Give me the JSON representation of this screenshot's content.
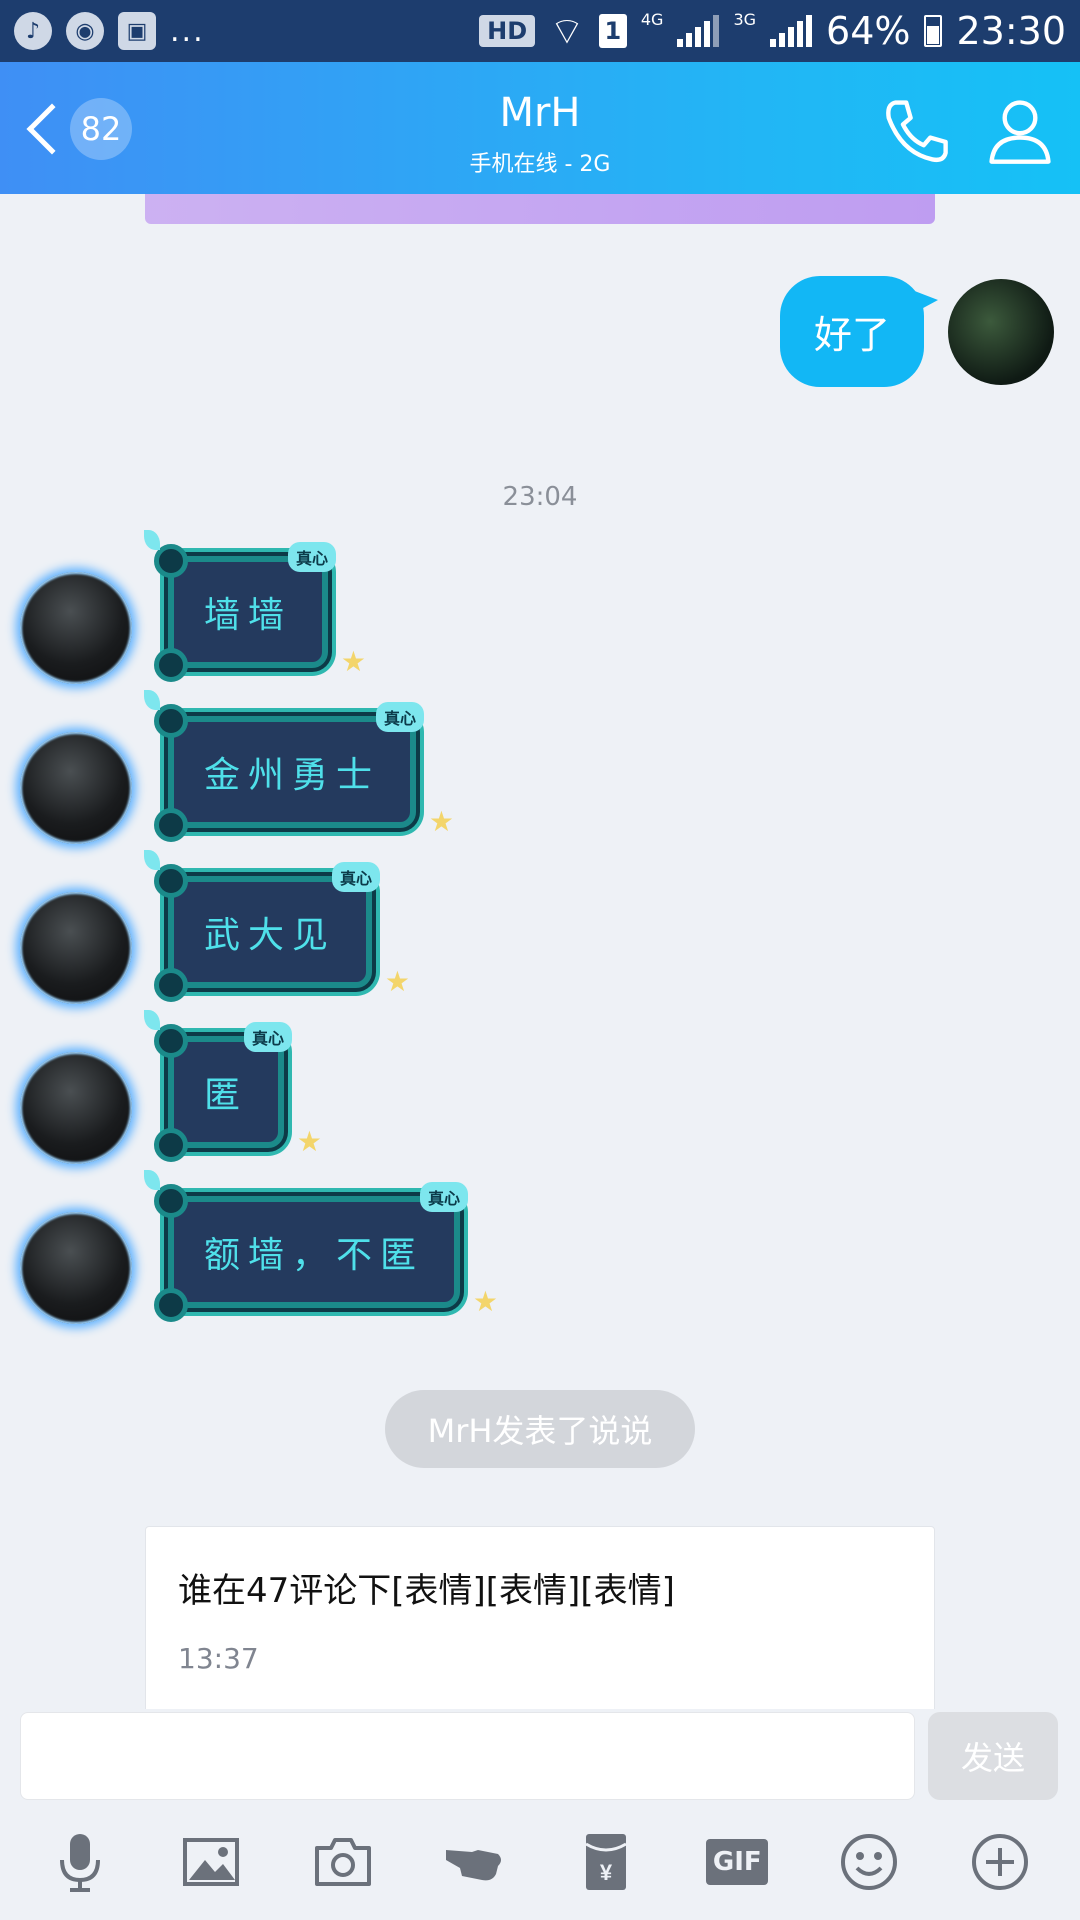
{
  "status_bar": {
    "hd": "HD",
    "sim": "1",
    "net1": "4G",
    "net2": "3G",
    "battery": "64%",
    "time": "23:30"
  },
  "header": {
    "unread_count": "82",
    "contact_name": "MrH",
    "contact_status": "手机在线 - 2G"
  },
  "chat": {
    "self_message": "好了",
    "timestamp": "23:04",
    "sticker_badge": "真心",
    "messages": [
      {
        "text": "墙墙"
      },
      {
        "text": "金州勇士"
      },
      {
        "text": "武大见"
      },
      {
        "text": "匿"
      },
      {
        "text": "额墙，不匿"
      }
    ],
    "notice": "MrH发表了说说",
    "post": {
      "text": "谁在47评论下[表情][表情][表情]",
      "time": "13:37"
    }
  },
  "input": {
    "placeholder": "",
    "send_label": "发送"
  },
  "toolbar": {
    "gif_label": "GIF"
  },
  "colors": {
    "header_start": "#3f8ff5",
    "header_end": "#15c1f6",
    "self_bubble": "#12b7f5",
    "sticker_text": "#4fe0ea"
  }
}
